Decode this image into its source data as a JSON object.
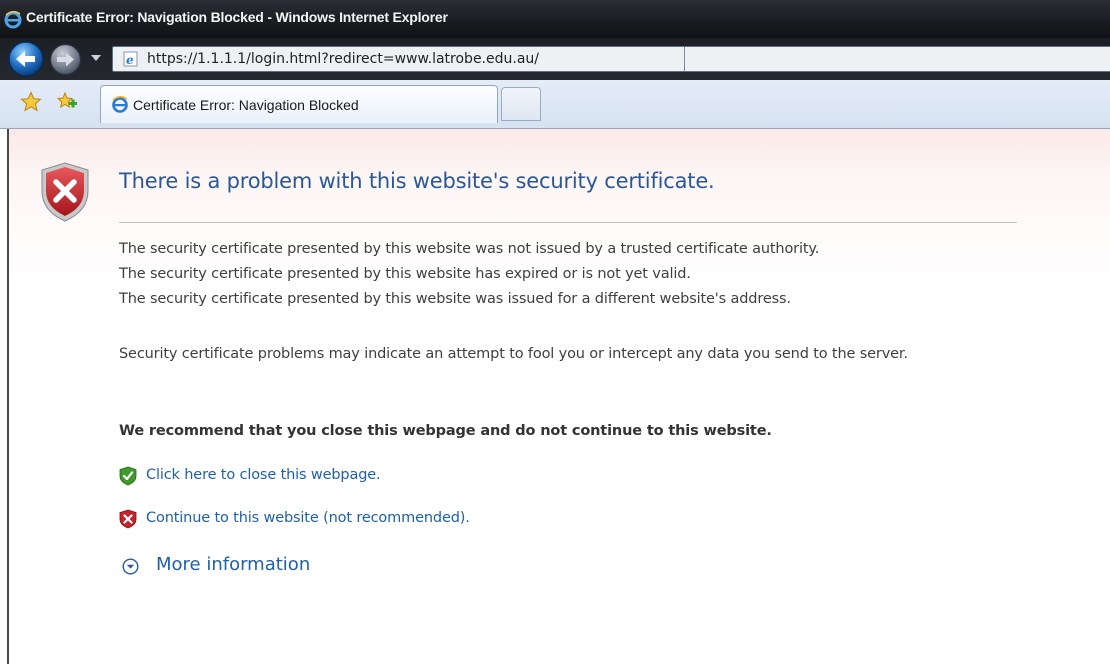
{
  "window": {
    "title": "Certificate Error: Navigation Blocked - Windows Internet Explorer",
    "app_icon": "ie-icon"
  },
  "navigation": {
    "back_icon": "back-arrow-icon",
    "forward_icon": "forward-arrow-icon",
    "history_icon": "chevron-down-icon",
    "address": "https://1.1.1.1/login.html?redirect=www.latrobe.edu.au/"
  },
  "tabs": {
    "favorites_icon": "star-icon",
    "add_favorites_icon": "add-favorite-icon",
    "items": [
      {
        "label": "Certificate Error: Navigation Blocked",
        "icon": "ie-icon"
      }
    ],
    "new_tab_icon": "new-tab-icon"
  },
  "content": {
    "heading": "There is a problem with this website's security certificate.",
    "reasons": [
      "The security certificate presented by this website was not issued by a trusted certificate authority.",
      "The security certificate presented by this website has expired or is not yet valid.",
      "The security certificate presented by this website was issued for a different website's address."
    ],
    "warning": "Security certificate problems may indicate an attempt to fool you or intercept any data you send to the server.",
    "recommendation": "We recommend that you close this webpage and do not continue to this website.",
    "close_link": "Click here to close this webpage.",
    "continue_link": "Continue to this website (not recommended).",
    "more_info": "More information"
  },
  "colors": {
    "heading": "#2b5797",
    "link": "#1f60a8",
    "shield_red": "#c2242a",
    "shield_green": "#3f9a2b"
  }
}
